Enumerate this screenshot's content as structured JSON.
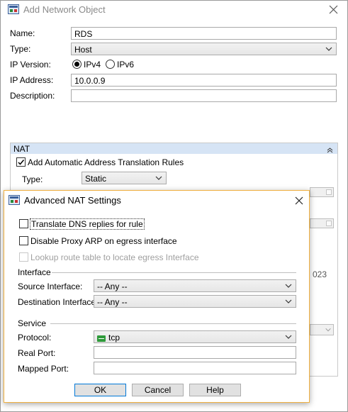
{
  "bg_dialog": {
    "title": "Add Network Object",
    "name_label": "Name:",
    "name_value": "RDS",
    "type_label": "Type:",
    "type_value": "Host",
    "ip_version_label": "IP Version:",
    "ipv4_label": "IPv4",
    "ipv6_label": "IPv6",
    "ip_address_label": "IP Address:",
    "ip_address_value": "10.0.0.9",
    "description_label": "Description:",
    "description_value": "",
    "nat_header": "NAT",
    "nat_auto_rules_label": "Add Automatic Address Translation Rules",
    "nat_type_label": "Type:",
    "nat_type_value": "Static",
    "partial_right_text": "023"
  },
  "fg_dialog": {
    "title": "Advanced NAT Settings",
    "translate_dns_label": "Translate DNS replies for rule",
    "disable_proxy_arp_label": "Disable Proxy ARP on egress interface",
    "lookup_route_label": "Lookup route table to locate egress Interface",
    "interface_group": "Interface",
    "source_interface_label": "Source Interface:",
    "source_interface_value": "-- Any --",
    "destination_interface_label": "Destination Interface:",
    "destination_interface_value": "-- Any --",
    "service_group": "Service",
    "protocol_label": "Protocol:",
    "protocol_value": "tcp",
    "real_port_label": "Real Port:",
    "real_port_value": "",
    "mapped_port_label": "Mapped Port:",
    "mapped_port_value": "",
    "ok_label": "OK",
    "cancel_label": "Cancel",
    "help_label": "Help"
  },
  "colors": {
    "nat_header_bg": "#d6e4f5",
    "fg_border": "#f0b040",
    "focus_border": "#0078d7"
  }
}
